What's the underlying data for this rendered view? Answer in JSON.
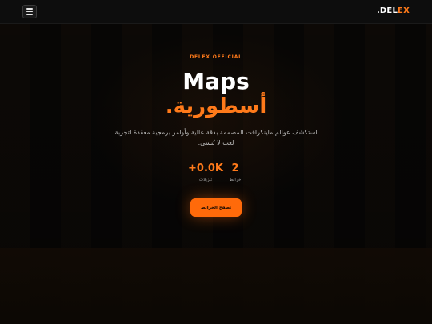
{
  "navbar": {
    "logo_main": ".DEL",
    "logo_accent": "EX",
    "menu_icon": "hamburger-menu-icon"
  },
  "hero": {
    "eyebrow": "DELEX OFFICIAL",
    "title_en": "Maps",
    "title_ar": "أسطورية.",
    "description": "استكشف عوالم ماينكرافت المصممة بدقة عالية وأوامر برمجية معقدة لتجربة لعب لا تُنسى."
  },
  "stats": [
    {
      "value": "2",
      "label": "خرائط"
    },
    {
      "value": "+0.0K",
      "label": "تنزيلات"
    }
  ],
  "cta": {
    "label": "تصفح الخرائط"
  },
  "colors": {
    "accent": "#ff7a1a",
    "background": "#060606",
    "button": "#ff6a0a"
  }
}
